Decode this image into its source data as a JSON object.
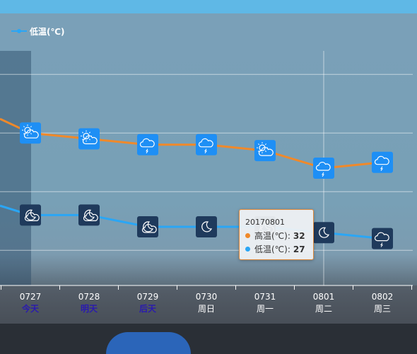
{
  "legend": {
    "low_label": "低温(℃)"
  },
  "colors": {
    "high": "#f0892a",
    "low": "#2aa6f5",
    "icon_day": "#1e8ff5",
    "icon_night": "#1f3a5c"
  },
  "days": [
    {
      "date": "0727",
      "weekday": "今天",
      "special": true
    },
    {
      "date": "0728",
      "weekday": "明天",
      "special": true
    },
    {
      "date": "0729",
      "weekday": "后天",
      "special": true
    },
    {
      "date": "0730",
      "weekday": "周日",
      "special": false
    },
    {
      "date": "0731",
      "weekday": "周一",
      "special": false
    },
    {
      "date": "0801",
      "weekday": "周二",
      "special": false
    },
    {
      "date": "0802",
      "weekday": "周三",
      "special": false
    }
  ],
  "chart_data": {
    "type": "line",
    "categories": [
      "0727",
      "0728",
      "0729",
      "0730",
      "0731",
      "0801",
      "0802"
    ],
    "series": [
      {
        "name": "高温(℃)",
        "color": "#f0892a",
        "values": [
          35,
          34.5,
          34,
          34,
          33.5,
          32,
          32.5
        ],
        "icons": [
          "partly-cloudy-sun-icon",
          "partly-cloudy-sun-icon",
          "thunderstorm-icon",
          "thunderstorm-icon",
          "partly-cloudy-sun-icon",
          "thunderstorm-icon",
          "thunderstorm-icon"
        ]
      },
      {
        "name": "低温(℃)",
        "color": "#2aa6f5",
        "values": [
          28,
          28,
          27,
          27,
          27,
          26.5,
          26
        ],
        "icons": [
          "cloudy-night-icon",
          "cloudy-night-icon",
          "cloudy-night-icon",
          "clear-night-icon",
          "cloudy-night-icon",
          "clear-night-icon",
          "thunderstorm-night-icon"
        ]
      }
    ],
    "ylim": [
      22,
      42
    ],
    "y_gridlines": [
      25,
      30,
      35,
      40
    ],
    "legend": "top-left",
    "highlighted_category": "0727"
  },
  "tooltip": {
    "date": "20170801",
    "high_name": "高温(℃)",
    "high_value": "32",
    "low_name": "低温(℃)",
    "low_value": "27",
    "separator": ":"
  }
}
